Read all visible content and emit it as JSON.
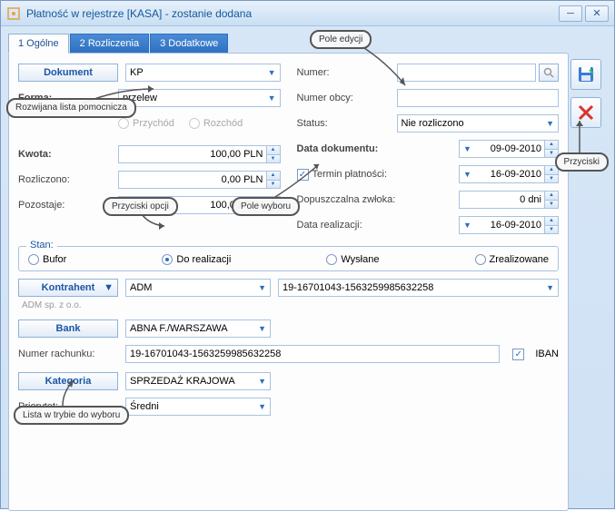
{
  "window": {
    "title": "Płatność w rejestrze [KASA] - zostanie dodana"
  },
  "tabs": {
    "t1": "1 Ogólne",
    "t2": "2 Rozliczenia",
    "t3": "3 Dodatkowe"
  },
  "left": {
    "dokument_btn": "Dokument",
    "dokument_val": "KP",
    "forma_lbl": "Forma:",
    "forma_val": "przelew",
    "przychod": "Przychód",
    "rozchod": "Rozchód",
    "kwota_lbl": "Kwota:",
    "kwota_val": "100,00 PLN",
    "rozliczono_lbl": "Rozliczono:",
    "rozliczono_val": "0,00 PLN",
    "pozostaje_lbl": "Pozostaje:",
    "pozostaje_val": "100,00 PLN"
  },
  "right": {
    "numer_lbl": "Numer:",
    "numer_obcy_lbl": "Numer obcy:",
    "status_lbl": "Status:",
    "status_val": "Nie rozliczono",
    "data_dok_lbl": "Data dokumentu:",
    "data_dok_val": "09-09-2010",
    "termin_lbl": "Termin płatności:",
    "termin_val": "16-09-2010",
    "zwloka_lbl": "Dopuszczalna zwłoka:",
    "zwloka_val": "0 dni",
    "realizacja_lbl": "Data realizacji:",
    "realizacja_val": "16-09-2010"
  },
  "stan": {
    "leg": "Stan:",
    "bufor": "Bufor",
    "do_realizacji": "Do realizacji",
    "wyslane": "Wysłane",
    "zrealizowane": "Zrealizowane"
  },
  "kontrahent": {
    "btn": "Kontrahent",
    "val": "ADM",
    "acct": "19-16701043-1563259985632258",
    "sub": "ADM sp. z o.o."
  },
  "bank": {
    "btn": "Bank",
    "val": "ABNA F./WARSZAWA",
    "rach_lbl": "Numer rachunku:",
    "rach_val": "19-16701043-1563259985632258",
    "iban": "IBAN"
  },
  "kategoria": {
    "btn": "Kategoria",
    "val": "SPRZEDAŻ KRAJOWA",
    "prio_lbl": "Priorytet:",
    "prio_val": "Średni"
  },
  "callouts": {
    "c1": "Rozwijana lista pomocnicza",
    "c2": "Przyciski opcji",
    "c3": "Pole wyboru",
    "c4": "Pole edycji",
    "c5": "Przyciski",
    "c6": "Lista w trybie do wyboru"
  }
}
